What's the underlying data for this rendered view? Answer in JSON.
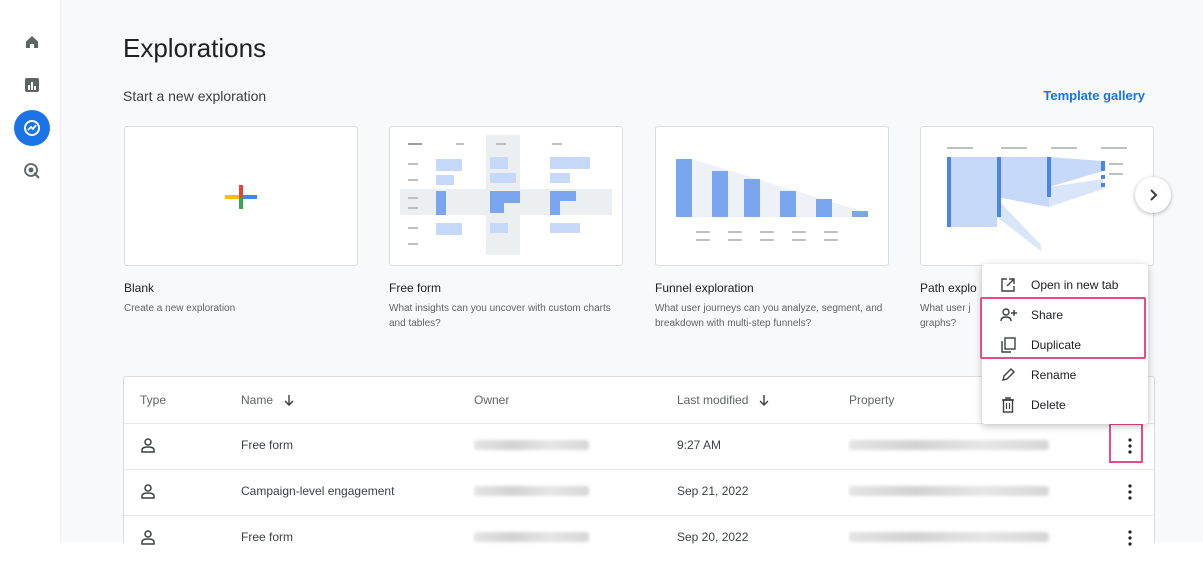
{
  "nav": {
    "items": [
      {
        "name": "home-icon"
      },
      {
        "name": "reports-icon"
      },
      {
        "name": "explore-icon",
        "active": true
      },
      {
        "name": "advertising-icon"
      }
    ]
  },
  "header": {
    "title": "Explorations",
    "section_title": "Start a new exploration",
    "template_gallery": "Template gallery"
  },
  "templates": [
    {
      "title": "Blank",
      "description": "Create a new exploration"
    },
    {
      "title": "Free form",
      "description": "What insights can you uncover with custom charts and tables?"
    },
    {
      "title": "Funnel exploration",
      "description": "What user journeys can you analyze, segment, and breakdown with multi-step funnels?"
    },
    {
      "title": "Path explo",
      "description": "What user j graphs?"
    }
  ],
  "table": {
    "columns": [
      "Type",
      "Name",
      "Owner",
      "Last modified",
      "Property"
    ],
    "rows": [
      {
        "name": "Free form",
        "last_modified": "9:27 AM"
      },
      {
        "name": "Campaign-level engagement",
        "last_modified": "Sep 21, 2022"
      },
      {
        "name": "Free form",
        "last_modified": "Sep 20, 2022"
      }
    ]
  },
  "context_menu": {
    "items": [
      {
        "label": "Open in new tab",
        "icon": "open-in-new-icon"
      },
      {
        "label": "Share",
        "icon": "share-icon"
      },
      {
        "label": "Duplicate",
        "icon": "duplicate-icon"
      },
      {
        "label": "Rename",
        "icon": "pencil-icon"
      },
      {
        "label": "Delete",
        "icon": "trash-icon"
      }
    ]
  },
  "colors": {
    "accent": "#1a73e8",
    "highlight": "#e94b8a",
    "chart_blue": "#7aa6f0",
    "chart_light": "#c6d9f8"
  }
}
